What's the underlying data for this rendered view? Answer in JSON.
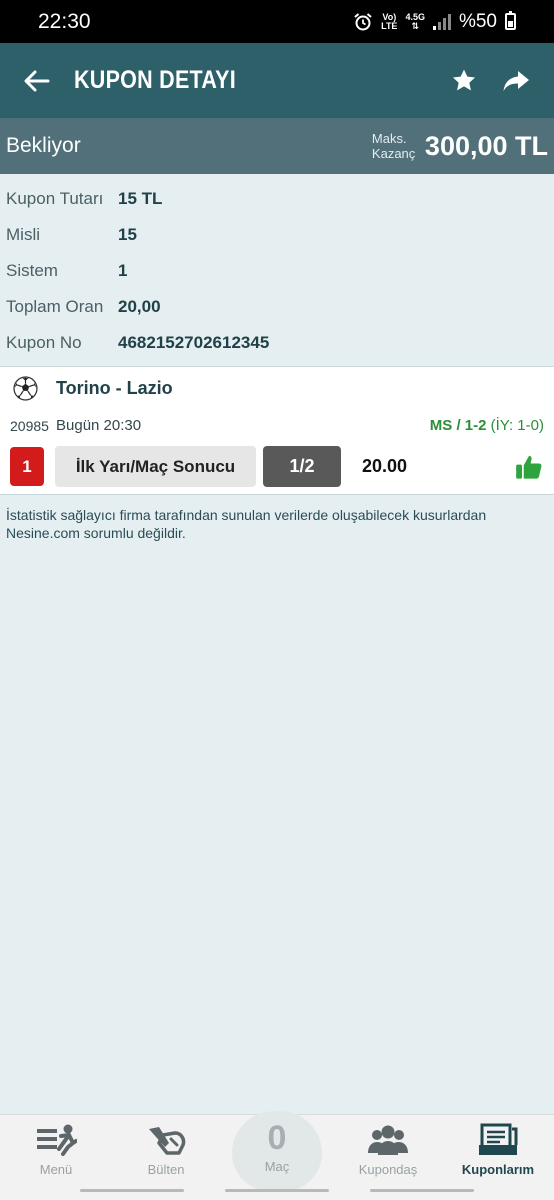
{
  "status_bar": {
    "time": "22:30",
    "net_top": "Vo)",
    "net_bottom": "LTE",
    "signal_label": "4.5G",
    "battery": "%50"
  },
  "header": {
    "title": "KUPON DETAYI"
  },
  "coupon": {
    "state": "Bekliyor",
    "max_win_label": "Maks. Kazanç",
    "max_win_value": "300,00 TL",
    "details": [
      {
        "label": "Kupon Tutarı",
        "value": "15 TL"
      },
      {
        "label": "Misli",
        "value": "15"
      },
      {
        "label": "Sistem",
        "value": "1"
      },
      {
        "label": "Toplam Oran",
        "value": "20,00"
      },
      {
        "label": "Kupon No",
        "value": "4682152702612345"
      }
    ]
  },
  "match": {
    "teams": "Torino - Lazio",
    "code": "20985",
    "time": "Bugün 20:30",
    "result_bold": "MS / 1-2",
    "result_half": " (İY: 1-0)",
    "pick_no": "1",
    "market": "İlk Yarı/Maç Sonucu",
    "selection": "1/2",
    "odd": "20.00"
  },
  "disclaimer": "İstatistik sağlayıcı firma tarafından sunulan verilerde oluşabilecek kusurlardan Nesine.com sorumlu değildir.",
  "nav": {
    "menu": "Menü",
    "bulletin": "Bülten",
    "match_count": "0",
    "match": "Maç",
    "kupondas": "Kupondaş",
    "my_coupons": "Kuponlarım"
  },
  "colors": {
    "header": "#2d6068",
    "strip": "#51707a",
    "background": "#e5eff1",
    "win_green": "#2a8f36",
    "pick_red": "#d41b1b"
  }
}
